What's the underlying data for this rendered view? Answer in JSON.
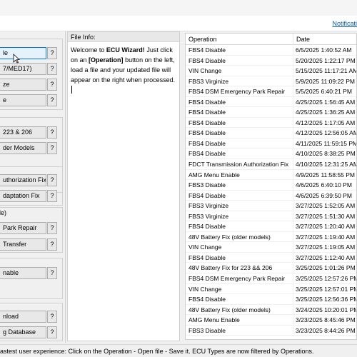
{
  "menu": {
    "notifications": "Notificati"
  },
  "left": {
    "groups": [
      {
        "title": ""
      },
      {
        "title": ""
      },
      {
        "title": ""
      },
      {
        "title": "le)"
      },
      {
        "title": ""
      },
      {
        "title": ""
      }
    ],
    "buttons": [
      {
        "label": "le"
      },
      {
        "label": "7/MED17)"
      },
      {
        "label": "ze"
      },
      {
        "label": "e"
      },
      {
        "label": "223 & 206"
      },
      {
        "label": "der Models"
      },
      {
        "label": "uthorization Fix"
      },
      {
        "label": "daptation Fix"
      },
      {
        "label": "Park Repair"
      },
      {
        "label": "Transfer"
      },
      {
        "label": "nable"
      },
      {
        "label": "nload"
      },
      {
        "label": "g Database"
      }
    ],
    "help_label": "?"
  },
  "info": {
    "header": "File Info:",
    "welcome": "Welcome to",
    "wizard": "ECU Wizard!",
    "just_click": "Just click on an",
    "operation": "[Operation]",
    "rest": "button on the left, load a file and your updated file will appear on the right when processed."
  },
  "grid": {
    "headers": {
      "operation": "Operation",
      "date": "Date"
    },
    "rows": [
      {
        "op": "FBS4 Disable",
        "date": "6/5/2025 1:40:52 AM"
      },
      {
        "op": "FBS4 Disable",
        "date": "5/20/2025 1:22:17 PM"
      },
      {
        "op": "VIN Change",
        "date": "5/15/2025 11:17:21 AM"
      },
      {
        "op": "FBS3 Virginize",
        "date": "5/9/2025 11:09:22 PM"
      },
      {
        "op": "FBS4 DSM Emergency Park Repair",
        "date": "5/5/2025 6:40:21 PM"
      },
      {
        "op": "FBS4 Disable",
        "date": "4/25/2025 1:56:45 AM"
      },
      {
        "op": "FBS4 Disable",
        "date": "4/25/2025 1:36:25 AM"
      },
      {
        "op": "FBS4 Disable",
        "date": "4/12/2025 1:17:05 AM"
      },
      {
        "op": "FBS4 Disable",
        "date": "4/12/2025 12:56:05 AM"
      },
      {
        "op": "FBS4 Disable",
        "date": "4/11/2025 11:59:15 PM"
      },
      {
        "op": "FBS4 Disable",
        "date": "4/10/2025 8:38:25 PM"
      },
      {
        "op": "FDCT Transmission Authorization Fix",
        "date": "4/10/2025 12:31:25 AM"
      },
      {
        "op": "AMG Menu Enable",
        "date": "4/9/2025 11:58:55 PM"
      },
      {
        "op": "FBS3 Disable",
        "date": "4/6/2025 6:40:10 PM"
      },
      {
        "op": "FBS4 Disable",
        "date": "4/6/2025 6:39:50 PM"
      },
      {
        "op": "FBS3 Virginize",
        "date": "3/27/2025 1:52:05 AM"
      },
      {
        "op": "FBS3 Virginize",
        "date": "3/27/2025 1:51:30 AM"
      },
      {
        "op": "FBS4 Disable",
        "date": "3/27/2025 1:20:40 AM"
      },
      {
        "op": "48V Battery Fix (older models)",
        "date": "3/27/2025 1:19:40 AM"
      },
      {
        "op": "VIN Change",
        "date": "3/27/2025 1:19:05 AM"
      },
      {
        "op": "FBS4 Disable",
        "date": "3/27/2025 1:12:40 AM"
      },
      {
        "op": "48V Battery Fix for 223 && 206",
        "date": "3/25/2025 1:01:26 PM"
      },
      {
        "op": "FBS4 DSM Emergency Park Repair",
        "date": "3/25/2025 12:57:26 PM"
      },
      {
        "op": "VIN Change",
        "date": "3/25/2025 12:57:01 PM"
      },
      {
        "op": "FBS4 Disable",
        "date": "3/25/2025 12:56:36 PM"
      },
      {
        "op": "48V Battery Fix (older models)",
        "date": "3/24/2025 10:20:01 PM"
      },
      {
        "op": "AMG Menu Enable",
        "date": "3/23/2025 8:45:46 PM"
      },
      {
        "op": "FBS3 Disable",
        "date": "3/23/2025 8:44:26 PM"
      }
    ]
  },
  "status": {
    "text": "astest user experience: Click on the Operation - Open file - Save it. ECU Types are now filtered by Operations."
  }
}
